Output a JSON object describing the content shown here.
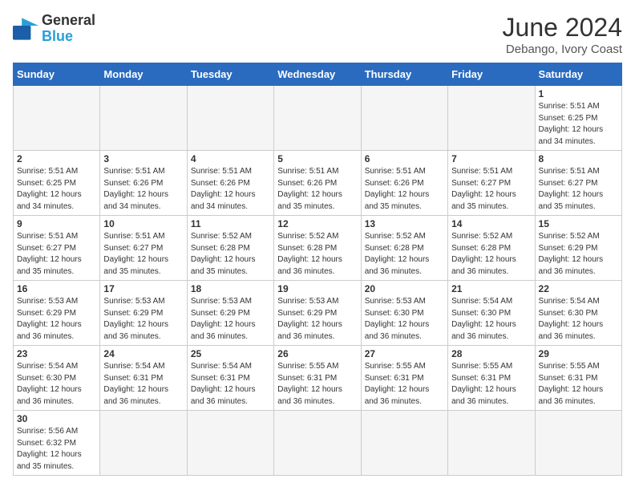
{
  "header": {
    "logo_general": "General",
    "logo_blue": "Blue",
    "month_year": "June 2024",
    "location": "Debango, Ivory Coast"
  },
  "days_of_week": [
    "Sunday",
    "Monday",
    "Tuesday",
    "Wednesday",
    "Thursday",
    "Friday",
    "Saturday"
  ],
  "weeks": [
    [
      {
        "day": "",
        "empty": true
      },
      {
        "day": "",
        "empty": true
      },
      {
        "day": "",
        "empty": true
      },
      {
        "day": "",
        "empty": true
      },
      {
        "day": "",
        "empty": true
      },
      {
        "day": "",
        "empty": true
      },
      {
        "day": "1",
        "sunrise": "5:51 AM",
        "sunset": "6:25 PM",
        "daylight": "12 hours and 34 minutes."
      }
    ],
    [
      {
        "day": "2",
        "sunrise": "5:51 AM",
        "sunset": "6:25 PM",
        "daylight": "12 hours and 34 minutes."
      },
      {
        "day": "3",
        "sunrise": "5:51 AM",
        "sunset": "6:26 PM",
        "daylight": "12 hours and 34 minutes."
      },
      {
        "day": "4",
        "sunrise": "5:51 AM",
        "sunset": "6:26 PM",
        "daylight": "12 hours and 34 minutes."
      },
      {
        "day": "5",
        "sunrise": "5:51 AM",
        "sunset": "6:26 PM",
        "daylight": "12 hours and 35 minutes."
      },
      {
        "day": "6",
        "sunrise": "5:51 AM",
        "sunset": "6:26 PM",
        "daylight": "12 hours and 35 minutes."
      },
      {
        "day": "7",
        "sunrise": "5:51 AM",
        "sunset": "6:27 PM",
        "daylight": "12 hours and 35 minutes."
      },
      {
        "day": "8",
        "sunrise": "5:51 AM",
        "sunset": "6:27 PM",
        "daylight": "12 hours and 35 minutes."
      }
    ],
    [
      {
        "day": "9",
        "sunrise": "5:51 AM",
        "sunset": "6:27 PM",
        "daylight": "12 hours and 35 minutes."
      },
      {
        "day": "10",
        "sunrise": "5:51 AM",
        "sunset": "6:27 PM",
        "daylight": "12 hours and 35 minutes."
      },
      {
        "day": "11",
        "sunrise": "5:52 AM",
        "sunset": "6:28 PM",
        "daylight": "12 hours and 35 minutes."
      },
      {
        "day": "12",
        "sunrise": "5:52 AM",
        "sunset": "6:28 PM",
        "daylight": "12 hours and 36 minutes."
      },
      {
        "day": "13",
        "sunrise": "5:52 AM",
        "sunset": "6:28 PM",
        "daylight": "12 hours and 36 minutes."
      },
      {
        "day": "14",
        "sunrise": "5:52 AM",
        "sunset": "6:28 PM",
        "daylight": "12 hours and 36 minutes."
      },
      {
        "day": "15",
        "sunrise": "5:52 AM",
        "sunset": "6:29 PM",
        "daylight": "12 hours and 36 minutes."
      }
    ],
    [
      {
        "day": "16",
        "sunrise": "5:53 AM",
        "sunset": "6:29 PM",
        "daylight": "12 hours and 36 minutes."
      },
      {
        "day": "17",
        "sunrise": "5:53 AM",
        "sunset": "6:29 PM",
        "daylight": "12 hours and 36 minutes."
      },
      {
        "day": "18",
        "sunrise": "5:53 AM",
        "sunset": "6:29 PM",
        "daylight": "12 hours and 36 minutes."
      },
      {
        "day": "19",
        "sunrise": "5:53 AM",
        "sunset": "6:29 PM",
        "daylight": "12 hours and 36 minutes."
      },
      {
        "day": "20",
        "sunrise": "5:53 AM",
        "sunset": "6:30 PM",
        "daylight": "12 hours and 36 minutes."
      },
      {
        "day": "21",
        "sunrise": "5:54 AM",
        "sunset": "6:30 PM",
        "daylight": "12 hours and 36 minutes."
      },
      {
        "day": "22",
        "sunrise": "5:54 AM",
        "sunset": "6:30 PM",
        "daylight": "12 hours and 36 minutes."
      }
    ],
    [
      {
        "day": "23",
        "sunrise": "5:54 AM",
        "sunset": "6:30 PM",
        "daylight": "12 hours and 36 minutes."
      },
      {
        "day": "24",
        "sunrise": "5:54 AM",
        "sunset": "6:31 PM",
        "daylight": "12 hours and 36 minutes."
      },
      {
        "day": "25",
        "sunrise": "5:54 AM",
        "sunset": "6:31 PM",
        "daylight": "12 hours and 36 minutes."
      },
      {
        "day": "26",
        "sunrise": "5:55 AM",
        "sunset": "6:31 PM",
        "daylight": "12 hours and 36 minutes."
      },
      {
        "day": "27",
        "sunrise": "5:55 AM",
        "sunset": "6:31 PM",
        "daylight": "12 hours and 36 minutes."
      },
      {
        "day": "28",
        "sunrise": "5:55 AM",
        "sunset": "6:31 PM",
        "daylight": "12 hours and 36 minutes."
      },
      {
        "day": "29",
        "sunrise": "5:55 AM",
        "sunset": "6:31 PM",
        "daylight": "12 hours and 36 minutes."
      }
    ],
    [
      {
        "day": "30",
        "sunrise": "5:56 AM",
        "sunset": "6:32 PM",
        "daylight": "12 hours and 35 minutes."
      },
      {
        "day": "",
        "empty": true
      },
      {
        "day": "",
        "empty": true
      },
      {
        "day": "",
        "empty": true
      },
      {
        "day": "",
        "empty": true
      },
      {
        "day": "",
        "empty": true
      },
      {
        "day": "",
        "empty": true
      }
    ]
  ],
  "labels": {
    "sunrise_prefix": "Sunrise: ",
    "sunset_prefix": "Sunset: ",
    "daylight_prefix": "Daylight: "
  }
}
